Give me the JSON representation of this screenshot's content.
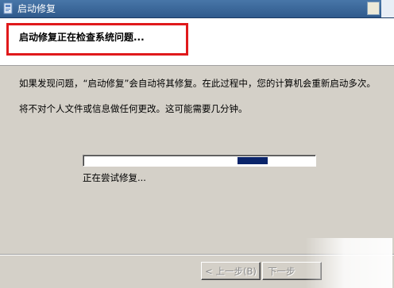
{
  "window": {
    "title": "启动修复"
  },
  "header": {
    "title": "启动修复正在检查系统问题..."
  },
  "body": {
    "paragraph1": "如果发现问题，“启动修复”会自动将其修复。在此过程中，您的计算机会重新启动多次。",
    "paragraph2": "将不对个人文件或信息做任何更改。这可能需要几分钟。"
  },
  "progress": {
    "status_text": "正在尝试修复...",
    "chunk_start_fraction": 0.67,
    "chunk_end_fraction": 0.8
  },
  "buttons": {
    "back_label": "< 上一步(B)",
    "next_label": "下一步"
  },
  "colors": {
    "titlebar": "#2f5a8c",
    "highlight_box": "#e0191b",
    "progress_chunk": "#0a246a",
    "dialog_background": "#d4d0c8"
  },
  "icons": {
    "app": "app-window-icon"
  }
}
